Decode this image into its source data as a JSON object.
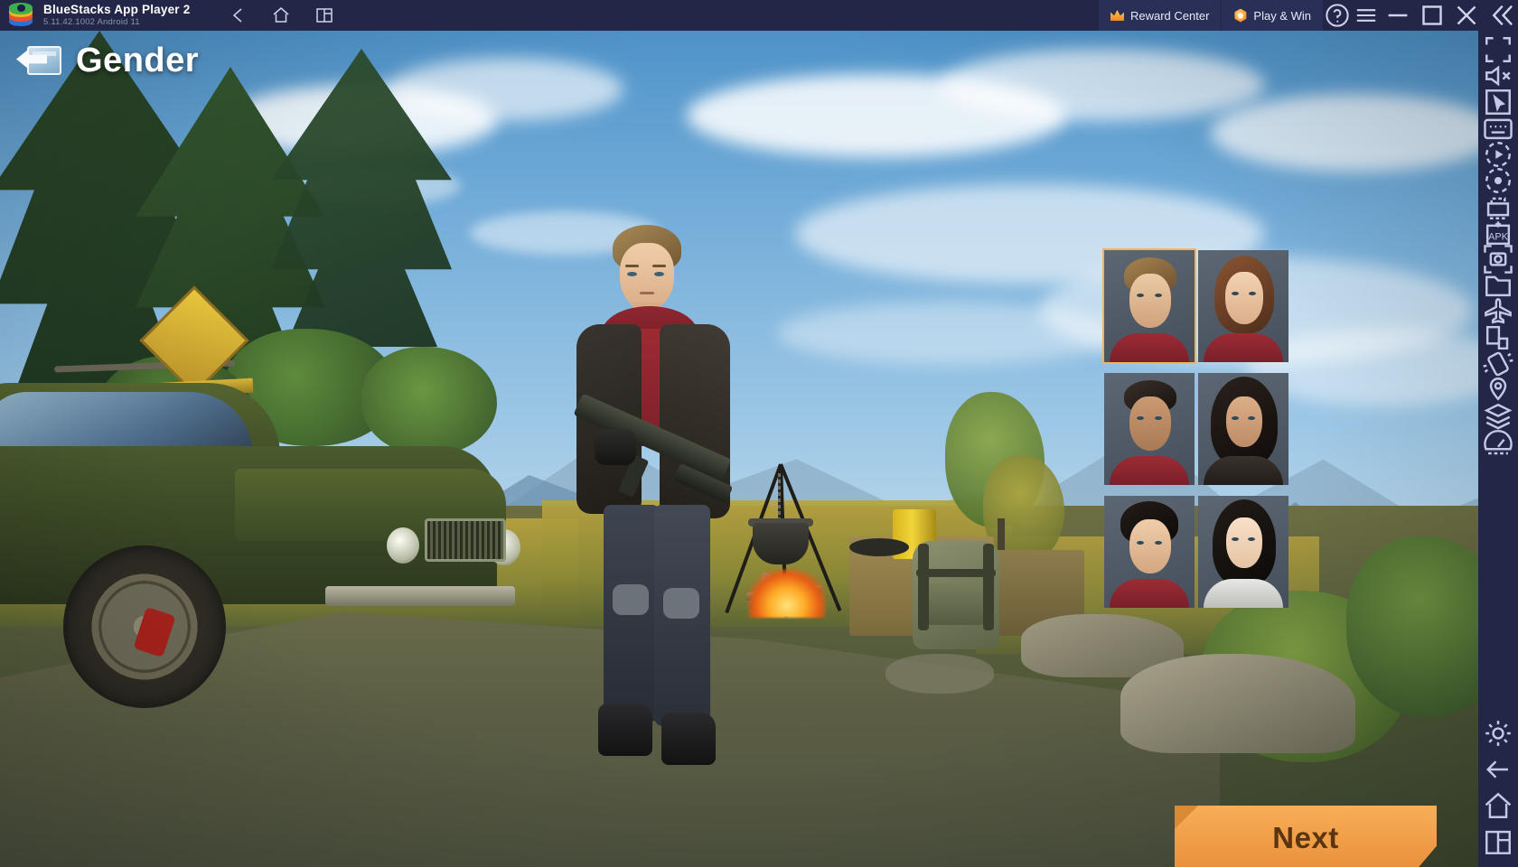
{
  "window": {
    "app_title": "BlueStacks App Player 2",
    "version_line": "5.11.42.1002  Android 11",
    "logo_icon": "bluestacks-logo-icon",
    "nav": [
      {
        "name": "back-icon",
        "label": "Back"
      },
      {
        "name": "home-icon",
        "label": "Home"
      },
      {
        "name": "multi-instance-icon",
        "label": "Instances"
      }
    ],
    "actions": [
      {
        "name": "reward-center-button",
        "label": "Reward Center",
        "icon": "crown-icon"
      },
      {
        "name": "play-and-win-button",
        "label": "Play & Win",
        "icon": "coin-icon"
      }
    ],
    "help_icon": "help-circle-icon",
    "menu_icon": "hamburger-menu-icon",
    "controls": [
      {
        "name": "minimize-button",
        "label": "Minimize"
      },
      {
        "name": "maximize-button",
        "label": "Maximize"
      },
      {
        "name": "close-button",
        "label": "Close"
      },
      {
        "name": "collapse-sidebar-button",
        "label": "Collapse"
      }
    ],
    "accent_color": "#f2a04a",
    "titlebar_color": "#232747",
    "pill_color": "#2a2f58"
  },
  "sidebar": {
    "top_items": [
      {
        "name": "fullscreen-icon",
        "label": "Full screen"
      },
      {
        "name": "mute-icon",
        "label": "Mute"
      },
      {
        "name": "cursor-pointer-icon",
        "label": "Pointer"
      },
      {
        "name": "keyboard-controls-icon",
        "label": "Game controls"
      },
      {
        "name": "macro-record-icon",
        "label": "Macro recorder"
      },
      {
        "name": "screen-record-icon",
        "label": "Screen record"
      },
      {
        "name": "multi-instance-manager-icon",
        "label": "Multi-instance manager"
      },
      {
        "name": "install-apk-icon",
        "label": "Install APK"
      },
      {
        "name": "screenshot-icon",
        "label": "Screenshot"
      },
      {
        "name": "media-manager-icon",
        "label": "Media manager"
      },
      {
        "name": "airplane-mode-icon",
        "label": "Airplane mode"
      },
      {
        "name": "rotate-screen-icon",
        "label": "Rotate"
      },
      {
        "name": "shake-icon",
        "label": "Shake"
      },
      {
        "name": "location-icon",
        "label": "Location"
      },
      {
        "name": "layers-icon",
        "label": "Eco mode"
      },
      {
        "name": "performance-icon",
        "label": "Performance"
      }
    ],
    "bottom_items": [
      {
        "name": "settings-gear-icon",
        "label": "Settings"
      },
      {
        "name": "android-back-icon",
        "label": "Back"
      },
      {
        "name": "android-home-icon",
        "label": "Home"
      },
      {
        "name": "android-recents-icon",
        "label": "Recent apps"
      }
    ]
  },
  "game": {
    "back_icon": "back-arrow-icon",
    "screen_title": "Gender",
    "next_button_label": "Next",
    "next_button_color": "#f2a04a",
    "selection_highlight_color": "#f5b556",
    "selected_index": 0,
    "portraits": [
      {
        "name": "portrait-male-blond",
        "label": "Male 1",
        "hair": "#8d6f42",
        "skin": "#eccaa6",
        "cloth": "#9d2b33",
        "selected": true
      },
      {
        "name": "portrait-female-brown",
        "label": "Female 1",
        "hair": "#7a4a2e",
        "skin": "#f0cdaa",
        "cloth": "#9d2b33",
        "selected": false
      },
      {
        "name": "portrait-male-dark",
        "label": "Male 2",
        "hair": "#2b241f",
        "skin": "#c79770",
        "cloth": "#9d2b33",
        "selected": false
      },
      {
        "name": "portrait-female-black",
        "label": "Female 2",
        "hair": "#191513",
        "skin": "#d8ab85",
        "cloth": "#2a2622",
        "selected": false
      },
      {
        "name": "portrait-male-black",
        "label": "Male 3",
        "hair": "#14110f",
        "skin": "#f0cdaa",
        "cloth": "#9d2b33",
        "selected": false
      },
      {
        "name": "portrait-female-asian",
        "label": "Female 3",
        "hair": "#17140f",
        "skin": "#f7ddc4",
        "cloth": "#e6e6e6",
        "selected": false
      }
    ],
    "scene": {
      "character": "male-survivor-with-rifle",
      "props": [
        "muscle-car",
        "road-sign",
        "campfire-with-pot",
        "supply-crate",
        "backpack",
        "yellow-barrel",
        "pine-trees",
        "mountains"
      ]
    }
  }
}
